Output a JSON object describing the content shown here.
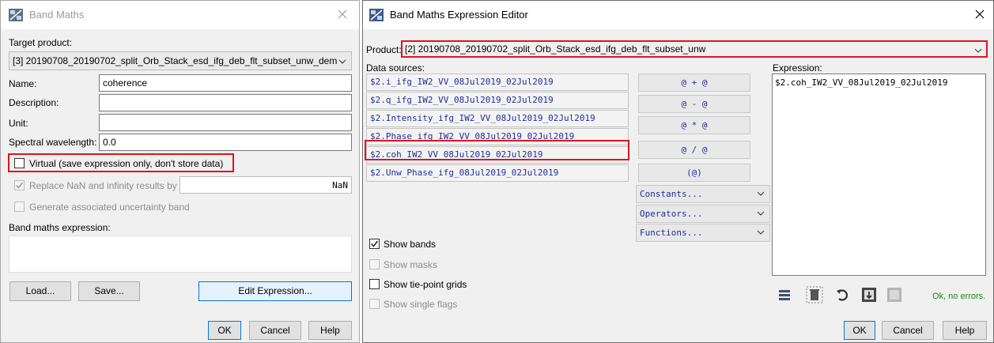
{
  "left_dialog": {
    "title": "Band Maths",
    "target_product_label": "Target product:",
    "target_product_value": "[3] 20190708_20190702_split_Orb_Stack_esd_ifg_deb_flt_subset_unw_dem",
    "name_label": "Name:",
    "name_value": "coherence",
    "description_label": "Description:",
    "description_value": "",
    "unit_label": "Unit:",
    "unit_value": "",
    "spectral_label": "Spectral wavelength:",
    "spectral_value": "0.0",
    "virtual_label": "Virtual (save expression only, don't store data)",
    "replace_nan_label": "Replace NaN and infinity results by",
    "replace_nan_value": "NaN",
    "uncertainty_label": "Generate associated uncertainty band",
    "expression_label": "Band maths expression:",
    "expression_value": "",
    "load_label": "Load...",
    "save_label": "Save...",
    "edit_expression_label": "Edit Expression...",
    "ok_label": "OK",
    "cancel_label": "Cancel",
    "help_label": "Help"
  },
  "right_dialog": {
    "title": "Band Maths Expression Editor",
    "product_label": "Product:",
    "product_value": "[2] 20190708_20190702_split_Orb_Stack_esd_ifg_deb_flt_subset_unw",
    "data_sources_label": "Data sources:",
    "data_sources": [
      "$2.i_ifg_IW2_VV_08Jul2019_02Jul2019",
      "$2.q_ifg_IW2_VV_08Jul2019_02Jul2019",
      "$2.Intensity_ifg_IW2_VV_08Jul2019_02Jul2019",
      "$2.Phase_ifg_IW2_VV_08Jul2019_02Jul2019",
      "$2.coh_IW2_VV_08Jul2019_02Jul2019",
      "$2.Unw_Phase_ifg_08Jul2019_02Jul2019"
    ],
    "operators": [
      "@ + @",
      "@ - @",
      "@ * @",
      "@ / @",
      "(@)"
    ],
    "constants_label": "Constants...",
    "operators_label": "Operators...",
    "functions_label": "Functions...",
    "show_bands_label": "Show bands",
    "show_masks_label": "Show masks",
    "show_tiepoint_label": "Show tie-point grids",
    "show_flags_label": "Show single flags",
    "expression_label": "Expression:",
    "expression_value": "$2.coh_IW2_VV_08Jul2019_02Jul2019",
    "status_text": "Ok, no errors.",
    "status_color": "#1a8a1a",
    "ok_label": "OK",
    "cancel_label": "Cancel",
    "help_label": "Help"
  },
  "colors": {
    "highlight": "#e0141c",
    "accent": "#0078d7"
  },
  "icons": [
    "band-maths-app-icon",
    "close-icon",
    "chevron-down-icon",
    "checkmark-icon",
    "history-icon",
    "delete-icon",
    "undo-icon",
    "import-icon",
    "export-icon"
  ]
}
